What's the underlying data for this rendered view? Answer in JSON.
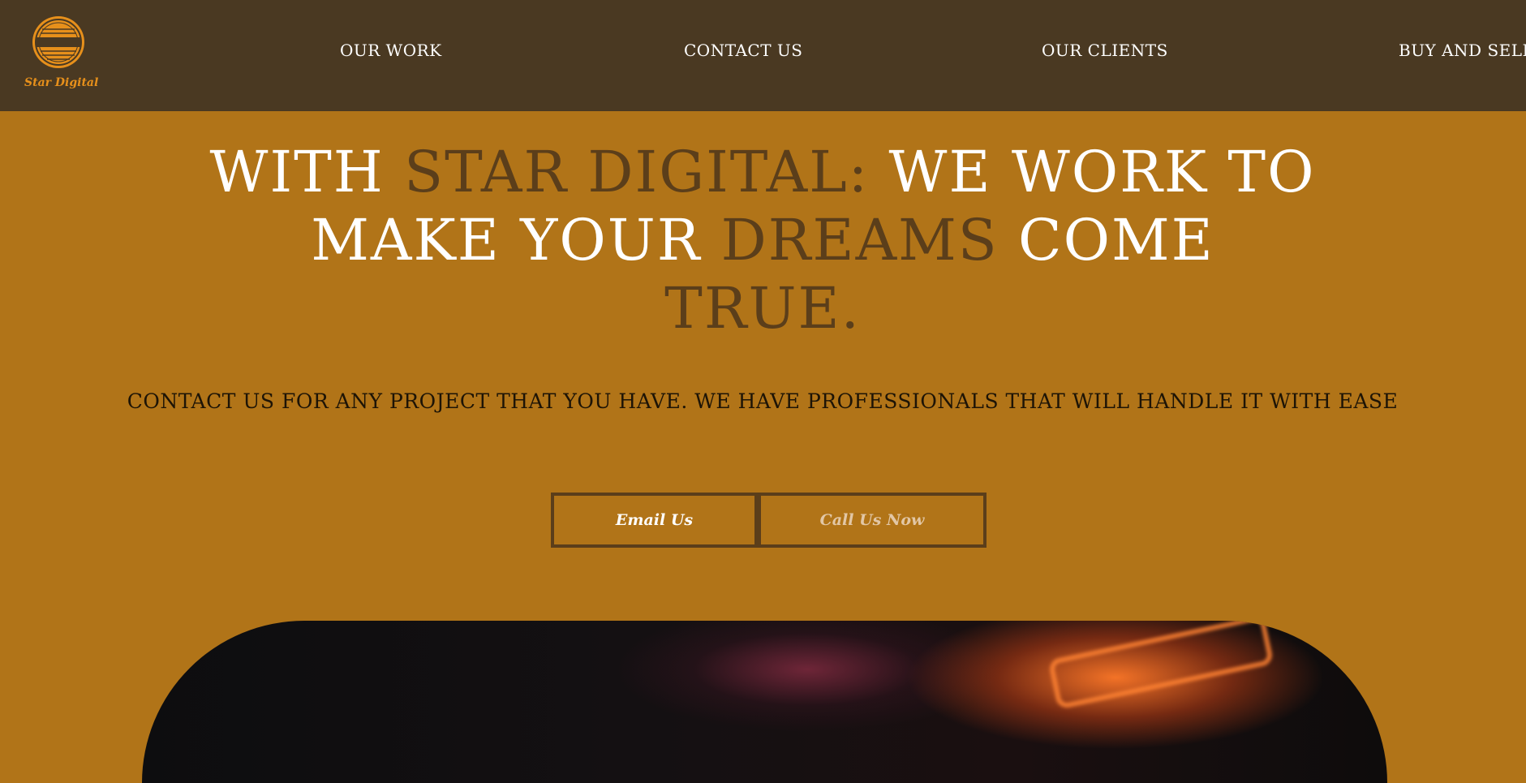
{
  "brand": {
    "name": "Star Digital",
    "logo_color": "#e7901b"
  },
  "nav": {
    "items": [
      {
        "label": "OUR WORK"
      },
      {
        "label": "CONTACT US"
      },
      {
        "label": "OUR CLIENTS"
      },
      {
        "label": "BUY AND SELL"
      }
    ]
  },
  "hero": {
    "title_parts": {
      "p1": "WITH ",
      "p2": "STAR DIGITAL:",
      "p3": " WE WORK TO MAKE YOUR ",
      "p4": "DREAMS",
      "p5": " COME",
      "p6": "TRUE."
    },
    "subtitle": "CONTACT US FOR ANY PROJECT THAT YOU HAVE. WE HAVE PROFESSIONALS THAT WILL HANDLE IT WITH EASE",
    "buttons": {
      "email": "Email Us",
      "call": "Call Us Now"
    }
  },
  "colors": {
    "header_bg": "#4a3922",
    "page_bg": "#b17418",
    "accent_text": "#5b3e1a",
    "title_text": "#ffffff"
  }
}
